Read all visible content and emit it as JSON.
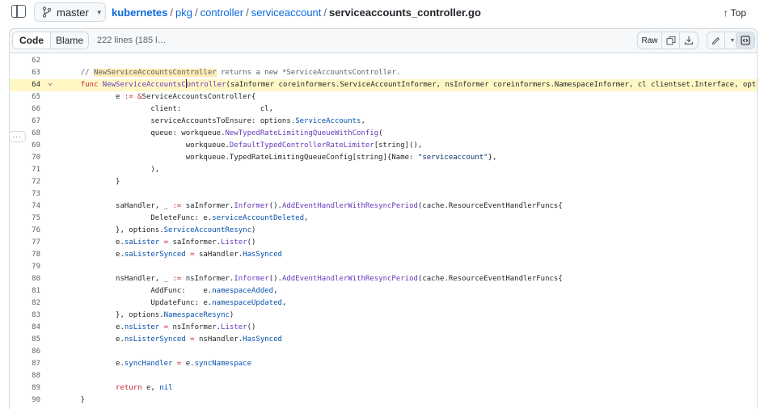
{
  "header": {
    "branch": "master",
    "breadcrumb": [
      "kubernetes",
      "pkg",
      "controller",
      "serviceaccount"
    ],
    "file_name": "serviceaccounts_controller.go",
    "top_label": "Top"
  },
  "file_header": {
    "code_tab": "Code",
    "blame_tab": "Blame",
    "lines_info": "222 lines (185 l…",
    "raw_label": "Raw"
  },
  "code": {
    "highlighted_line": 64,
    "lines": [
      {
        "n": "62",
        "html": ""
      },
      {
        "n": "63",
        "html": "    <span class=\"c\">// <span class=\"mark\">NewServiceAccountsController</span> returns a new *ServiceAccountsController.</span>"
      },
      {
        "n": "64",
        "html": "    <span class=\"k\">func</span> <span class=\"f\">NewServiceAccountsC<span class=\"caret-cursor\"></span>ontroller</span>(saInformer coreinformers.ServiceAccountInformer, nsInformer coreinformers.NamespaceInformer, cl clientset.Interface, options"
      },
      {
        "n": "65",
        "html": "            e <span class=\"k\">:=</span> <span class=\"k\">&amp;</span>ServiceAccountsController{"
      },
      {
        "n": "66",
        "html": "                    client:                  cl,"
      },
      {
        "n": "67",
        "html": "                    serviceAccountsToEnsure: options.<span class=\"p\">ServiceAccounts</span>,"
      },
      {
        "n": "68",
        "html": "                    queue: workqueue.<span class=\"f\">NewTypedRateLimitingQueueWithConfig</span>("
      },
      {
        "n": "69",
        "html": "                            workqueue.<span class=\"f\">DefaultTypedControllerRateLimiter</span>[string](),"
      },
      {
        "n": "70",
        "html": "                            workqueue.TypedRateLimitingQueueConfig[string]{Name: <span class=\"s\">\"serviceaccount\"</span>},"
      },
      {
        "n": "71",
        "html": "                    ),"
      },
      {
        "n": "72",
        "html": "            }"
      },
      {
        "n": "73",
        "html": ""
      },
      {
        "n": "74",
        "html": "            saHandler, _ <span class=\"k\">:=</span> saInformer.<span class=\"f\">Informer</span>().<span class=\"f\">AddEventHandlerWithResyncPeriod</span>(cache.ResourceEventHandlerFuncs{"
      },
      {
        "n": "75",
        "html": "                    DeleteFunc: e.<span class=\"p\">serviceAccountDeleted</span>,"
      },
      {
        "n": "76",
        "html": "            }, options.<span class=\"p\">ServiceAccountResync</span>)"
      },
      {
        "n": "77",
        "html": "            e.<span class=\"p\">saLister</span> <span class=\"k\">=</span> saInformer.<span class=\"f\">Lister</span>()"
      },
      {
        "n": "78",
        "html": "            e.<span class=\"p\">saListerSynced</span> <span class=\"k\">=</span> saHandler.<span class=\"p\">HasSynced</span>"
      },
      {
        "n": "79",
        "html": ""
      },
      {
        "n": "80",
        "html": "            nsHandler, _ <span class=\"k\">:=</span> nsInformer.<span class=\"f\">Informer</span>().<span class=\"f\">AddEventHandlerWithResyncPeriod</span>(cache.ResourceEventHandlerFuncs{"
      },
      {
        "n": "81",
        "html": "                    AddFunc:    e.<span class=\"p\">namespaceAdded</span>,"
      },
      {
        "n": "82",
        "html": "                    UpdateFunc: e.<span class=\"p\">namespaceUpdated</span>,"
      },
      {
        "n": "83",
        "html": "            }, options.<span class=\"p\">NamespaceResync</span>)"
      },
      {
        "n": "84",
        "html": "            e.<span class=\"p\">nsLister</span> <span class=\"k\">=</span> nsInformer.<span class=\"f\">Lister</span>()"
      },
      {
        "n": "85",
        "html": "            e.<span class=\"p\">nsListerSynced</span> <span class=\"k\">=</span> nsHandler.<span class=\"p\">HasSynced</span>"
      },
      {
        "n": "86",
        "html": ""
      },
      {
        "n": "87",
        "html": "            e.<span class=\"p\">syncHandler</span> <span class=\"k\">=</span> e.<span class=\"p\">syncNamespace</span>"
      },
      {
        "n": "88",
        "html": ""
      },
      {
        "n": "89",
        "html": "            <span class=\"k\">return</span> e, <span class=\"p\">nil</span>"
      },
      {
        "n": "90",
        "html": "    }"
      }
    ]
  },
  "colors": {
    "link": "#0969da",
    "highlight_line": "#fff8c5",
    "keyword": "#cf222e",
    "function": "#6639ba",
    "property": "#0550ae",
    "string": "#0a3069",
    "comment": "#59636e"
  }
}
